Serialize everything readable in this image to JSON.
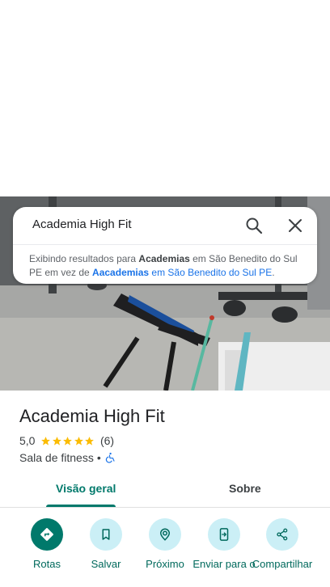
{
  "search": {
    "query": "Academia High Fit",
    "note_prefix": "Exibindo resultados para ",
    "note_term": "Academias",
    "note_loc": " em São Benedito do Sul PE",
    "note_mid": " em vez de ",
    "note_alt_term": "Aacademias",
    "note_alt_loc": " em São Benedito do Sul PE",
    "note_end": "."
  },
  "place": {
    "name": "Academia High Fit",
    "rating": "5,0",
    "stars": 5,
    "reviews": "(6)",
    "category": "Sala de fitness",
    "separator": "•"
  },
  "tabs": [
    {
      "label": "Visão geral",
      "active": true
    },
    {
      "label": "Sobre",
      "active": false
    }
  ],
  "actions": [
    {
      "label": "Rotas",
      "icon": "directions-icon"
    },
    {
      "label": "Salvar",
      "icon": "bookmark-icon"
    },
    {
      "label": "Próximo",
      "icon": "nearby-icon"
    },
    {
      "label": "Enviar para o",
      "icon": "send-to-phone-icon"
    },
    {
      "label": "Compartilhar",
      "icon": "share-icon"
    }
  ],
  "colors": {
    "accent": "#00796b",
    "star": "#fbbc04",
    "link": "#1a73e8",
    "action_bg": "#cbeff6"
  }
}
